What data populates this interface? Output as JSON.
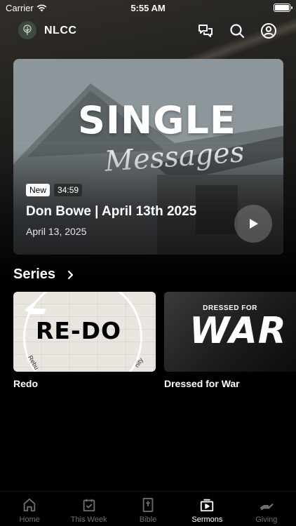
{
  "status_bar": {
    "carrier": "Carrier",
    "time": "5:55 AM",
    "battery_level": 1.0
  },
  "header": {
    "title": "NLCC",
    "icons": [
      "chat-icon",
      "search-icon",
      "profile-icon"
    ]
  },
  "hero": {
    "art_title": "SINGLE",
    "art_subtitle": "Messages",
    "badge_new": "New",
    "duration": "34:59",
    "title": "Don Bowe | April 13th 2025",
    "date": "April 13, 2025"
  },
  "series": {
    "title": "Series",
    "items": [
      {
        "label": "Redo",
        "art_text": "RE-DO",
        "art_small_left": "Rebu",
        "art_small_right": "nity"
      },
      {
        "label": "Dressed for War",
        "art_top": "DRESSED FOR",
        "art_main": "WAR"
      }
    ]
  },
  "tabs": [
    {
      "label": "Home",
      "icon": "home-icon",
      "active": false
    },
    {
      "label": "This Week",
      "icon": "calendar-icon",
      "active": false
    },
    {
      "label": "Bible",
      "icon": "bible-icon",
      "active": false
    },
    {
      "label": "Sermons",
      "icon": "sermons-icon",
      "active": true
    },
    {
      "label": "Giving",
      "icon": "giving-icon",
      "active": false
    }
  ],
  "colors": {
    "background": "#000000",
    "active_tab": "#ffffff",
    "inactive_tab": "#6f6f6f"
  }
}
